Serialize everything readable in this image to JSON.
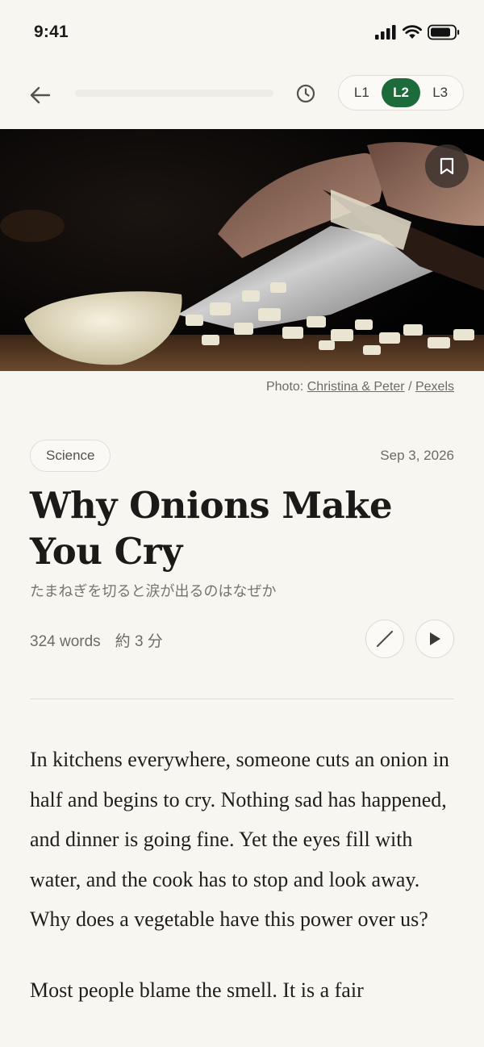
{
  "status_bar": {
    "time": "9:41"
  },
  "nav": {
    "back_icon": "arrow-left-icon",
    "reading_progress": 0,
    "history_icon": "clock-icon",
    "levels": [
      {
        "label": "L1",
        "active": false
      },
      {
        "label": "L2",
        "active": true
      },
      {
        "label": "L3",
        "active": false
      }
    ]
  },
  "hero": {
    "alt": "Knife cutting a chopped onion on a cutting board",
    "bookmark_icon": "bookmark-icon"
  },
  "caption": {
    "prefix": "Photo: ",
    "author": "Christina & Peter",
    "separator": " / ",
    "source": "Pexels"
  },
  "article": {
    "category": "Science",
    "date": "Sep 3, 2026",
    "title": "Why Onions Make You Cry",
    "subtitle": "たまねぎを切ると涙が出るのはなぜか",
    "word_count": "324 words",
    "read_time": "約 3 分",
    "paragraphs": [
      "In kitchens everywhere, someone cuts an onion in half and begins to cry. Nothing sad has happened, and dinner is going fine. Yet the eyes fill with water, and the cook has to stop and look away. Why does a vegetable have this power over us?",
      "Most people blame the smell. It is a fair"
    ]
  },
  "colors": {
    "background": "#f8f6f1",
    "accent": "#1d6b3a",
    "text": "#1d1c1a",
    "muted": "#6e6b64"
  }
}
